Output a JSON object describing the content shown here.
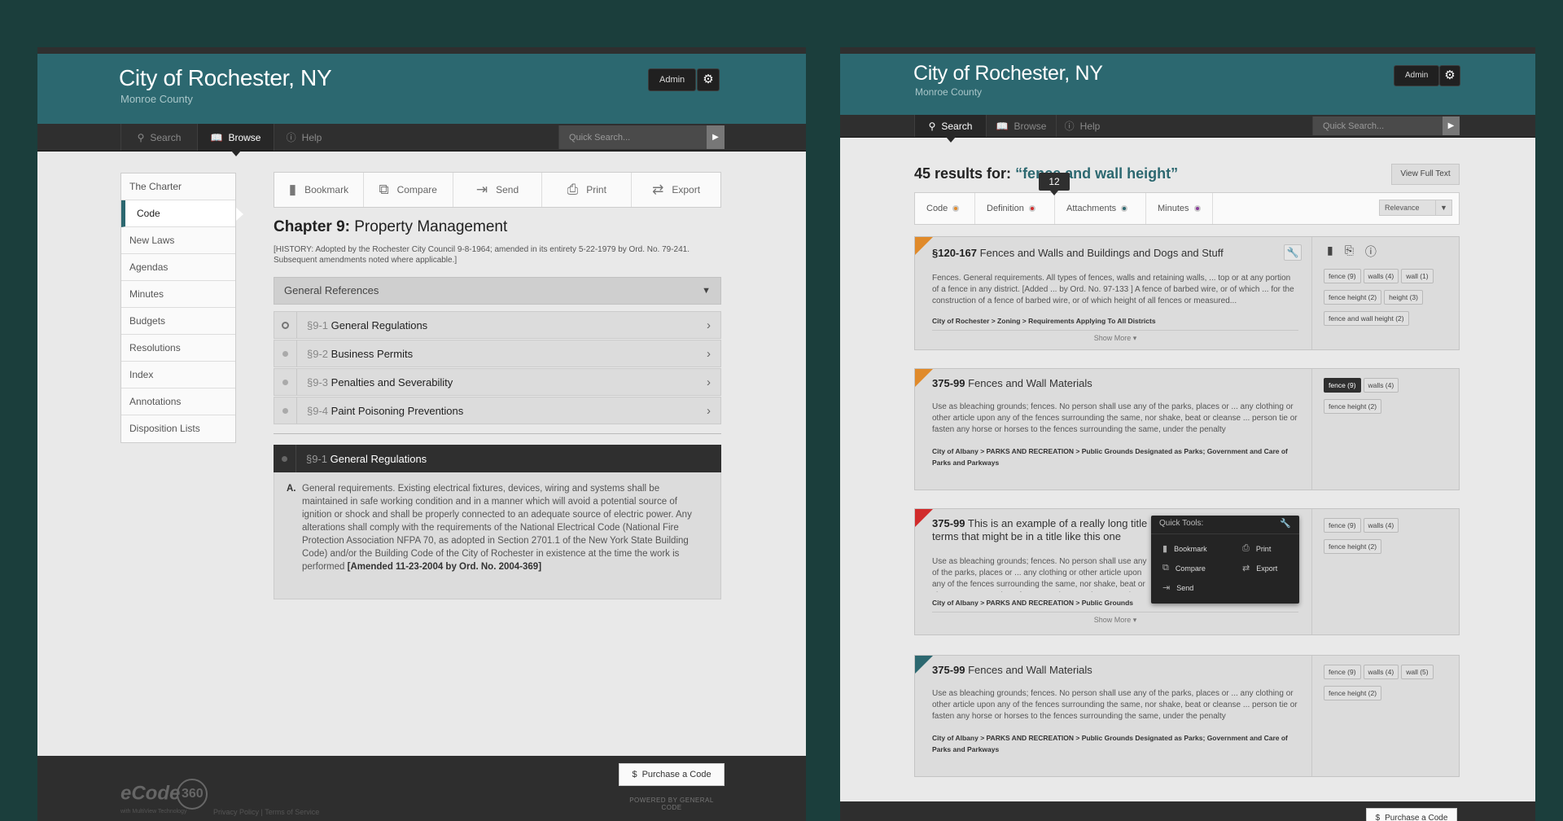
{
  "city": "City of Rochester, NY",
  "county": "Monroe County",
  "admin": "Admin",
  "nav": {
    "search": "Search",
    "browse": "Browse",
    "help": "Help",
    "quick_placeholder": "Quick Search..."
  },
  "left": {
    "sidebar": [
      "The Charter",
      "Code",
      "New Laws",
      "Agendas",
      "Minutes",
      "Budgets",
      "Resolutions",
      "Index",
      "Annotations",
      "Disposition Lists"
    ],
    "toolbar": {
      "bookmark": "Bookmark",
      "compare": "Compare",
      "send": "Send",
      "print": "Print",
      "export": "Export"
    },
    "chapter_label": "Chapter 9:",
    "chapter_title": "Property Management",
    "history": "[HISTORY: Adopted by the Rochester City Council 9-8-1964; amended in its entirety 5-22-1979 by Ord. No. 79-241. Subsequent amendments noted where applicable.]",
    "general_references": "General References",
    "sections": [
      {
        "num": "§9-1",
        "title": "General Regulations"
      },
      {
        "num": "§9-2",
        "title": "Business Permits"
      },
      {
        "num": "§9-3",
        "title": "Penalties and Severability"
      },
      {
        "num": "§9-4",
        "title": "Paint Poisoning Preventions"
      }
    ],
    "open": {
      "num": "§9-1",
      "title": "General Regulations",
      "letter": "A.",
      "text": "General requirements. Existing electrical fixtures, devices, wiring and systems shall be maintained in safe working condition and in a manner which will avoid a potential source of ignition or shock and shall be properly connected to an adequate source of electric power. Any alterations shall comply with the requirements of the National Electrical Code (National Fire Protection Association NFPA 70, as adopted in Section 2701.1 of the New York State Building Code) and/or the Building Code of the City of Rochester in existence at the time the work is performed",
      "amend": "[Amended 11-23-2004 by Ord. No. 2004-369]"
    },
    "footer": {
      "logo": "eCode",
      "logo_num": "360",
      "multiview": "with MultiView Technology",
      "privacy": "Privacy Policy | Terms of Service",
      "purchase": "Purchase a Code",
      "powered": "POWERED BY GENERAL CODE"
    }
  },
  "right": {
    "results_prefix": "45 results for:",
    "query": "“fence and wall height”",
    "view_full": "View Full Text",
    "filters": [
      {
        "label": "Code",
        "color": "#e08a2a"
      },
      {
        "label": "Definition",
        "color": "#d12b2b"
      },
      {
        "label": "Attachments",
        "color": "#2c6870"
      },
      {
        "label": "Minutes",
        "color": "#8a3a9a"
      }
    ],
    "bubble": "12",
    "relevance": "Relevance",
    "results": [
      {
        "num": "§120-167",
        "title": "Fences and Walls and Buildings and Dogs and Stuff",
        "excerpt": "Fences. General requirements. All types of fences, walls and retaining walls, ... top or at any portion of a fence in any district. [Added ... by Ord. No. 97-133 ] A fence of barbed wire, or of which ... for the construction of a fence of barbed wire, or of which height of all fences or measured...",
        "crumb": "City of Rochester > Zoning > Requirements Applying To All Districts",
        "more": "Show More",
        "tags": [
          "fence (9)",
          "walls (4)",
          "wall (1)",
          "fence height (2)",
          "height (3)",
          "fence and wall height (2)"
        ]
      },
      {
        "num": "375-99",
        "title": "Fences and Wall Materials",
        "excerpt": "Use as bleaching grounds; fences. No person shall use any of the parks, places or ... any clothing or other article upon any of the fences surrounding the same, nor shake, beat or cleanse ... person tie or fasten any horse or horses to the fences surrounding the same, under the penalty",
        "crumb": "City of Albany > PARKS AND RECREATION > Public Grounds Designated as Parks; Government and Care of Parks and Parkways",
        "tags": [
          "fence (9)",
          "walls (4)",
          "fence height (2)"
        ]
      },
      {
        "num": "375-99",
        "title": "This is an example of a really long title terms that might be in a title like this one",
        "excerpt": "Use as bleaching grounds; fences. No person shall use any of the parks, places or ... any clothing or other article upon any of the fences surrounding the same, nor shake, beat or cleanse ... person tie or fasten any horse or horses to the fences surrounding the same",
        "crumb": "City of Albany > PARKS AND RECREATION > Public Grounds",
        "more": "Show More",
        "tags": [
          "fence (9)",
          "walls (4)",
          "fence height (2)"
        ]
      },
      {
        "num": "375-99",
        "title": "Fences and Wall Materials",
        "excerpt": "Use as bleaching grounds; fences. No person shall use any of the parks, places or ... any clothing or other article upon any of the fences surrounding the same, nor shake, beat or cleanse ... person tie or fasten any horse or horses to the fences surrounding the same, under the penalty",
        "crumb": "City of Albany > PARKS AND RECREATION > Public Grounds Designated as Parks; Government and Care of Parks and Parkways",
        "tags": [
          "fence (9)",
          "walls (4)",
          "wall (5)",
          "fence height (2)"
        ]
      }
    ],
    "quick_tools": {
      "title": "Quick Tools:",
      "bookmark": "Bookmark",
      "print": "Print",
      "compare": "Compare",
      "export": "Export",
      "send": "Send"
    },
    "footer_purchase": "Purchase a Code"
  }
}
